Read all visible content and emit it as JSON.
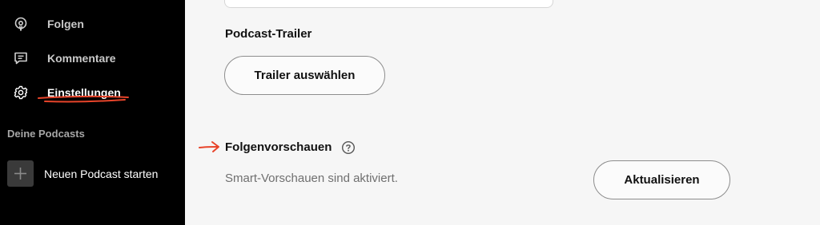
{
  "sidebar": {
    "items": [
      {
        "label": "Folgen",
        "icon": "podcast-icon"
      },
      {
        "label": "Kommentare",
        "icon": "comment-icon"
      },
      {
        "label": "Einstellungen",
        "icon": "gear-icon",
        "active": true
      }
    ],
    "section_title": "Deine Podcasts",
    "new_podcast": {
      "label": "Neuen Podcast starten",
      "icon": "plus-icon"
    }
  },
  "main": {
    "trailer": {
      "heading": "Podcast-Trailer",
      "button_label": "Trailer auswählen"
    },
    "previews": {
      "heading": "Folgenvorschauen",
      "help_icon": "help-circle-icon",
      "status": "Smart-Vorschauen sind aktiviert.",
      "button_label": "Aktualisieren"
    }
  },
  "colors": {
    "sidebar_bg": "#000000",
    "main_bg": "#f6f6f6",
    "annotation_red": "#e8442a"
  }
}
